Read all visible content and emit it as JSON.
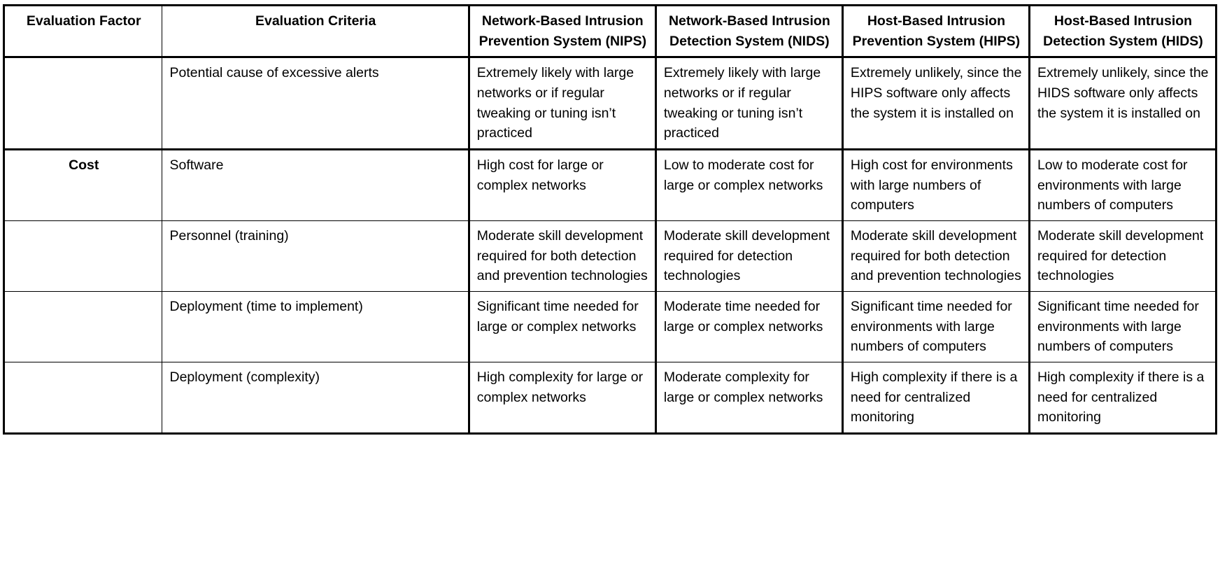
{
  "table": {
    "headers": [
      "Evaluation Factor",
      "Evaluation Criteria",
      "Network-Based Intrusion Prevention System (NIPS)",
      "Network-Based Intrusion Detection System (NIDS)",
      "Host-Based Intrusion Prevention System (HIPS)",
      "Host-Based Intrusion Detection System (HIDS)"
    ],
    "rows": [
      {
        "factor": "",
        "criteria": "Potential cause of excessive alerts",
        "nips": "Extremely likely with large networks or if regular tweaking or tuning isn’t practiced",
        "nids": "Extremely likely with large networks or if regular tweaking or tuning isn’t practiced",
        "hips": "Extremely unlikely, since the HIPS software only affects the system it is installed on",
        "hids": "Extremely unlikely, since the HIDS software only affects the system it is installed on"
      },
      {
        "factor": "Cost",
        "criteria": "Software",
        "nips": "High cost for large or complex networks",
        "nids": "Low to moderate cost for large or complex networks",
        "hips": "High cost for environments with large numbers of computers",
        "hids": "Low to moderate cost for environments with large numbers of computers"
      },
      {
        "factor": "",
        "criteria": "Personnel (training)",
        "nips": "Moderate skill development required for both detection and prevention technologies",
        "nids": "Moderate skill development required for detection technologies",
        "hips": "Moderate skill development required for both detection and prevention technologies",
        "hids": "Moderate skill development required for detection technologies"
      },
      {
        "factor": "",
        "criteria": "Deployment (time to implement)",
        "nips": "Significant time needed for large or complex networks",
        "nids": "Moderate time needed for large or complex networks",
        "hips": "Significant time needed for environments with large numbers of computers",
        "hids": "Significant time needed for environments with large numbers of computers"
      },
      {
        "factor": "",
        "criteria": "Deployment (complexity)",
        "nips": "High complexity for large or complex networks",
        "nids": "Moderate complexity for large or complex networks",
        "hips": "High complexity if there is a need for centralized monitoring",
        "hids": "High complexity if there is a need for centralized monitoring"
      }
    ]
  },
  "style": {
    "header_background": "#f2f2f2",
    "border_color": "#000000",
    "text_color": "#000000",
    "page_background": "#ffffff"
  }
}
